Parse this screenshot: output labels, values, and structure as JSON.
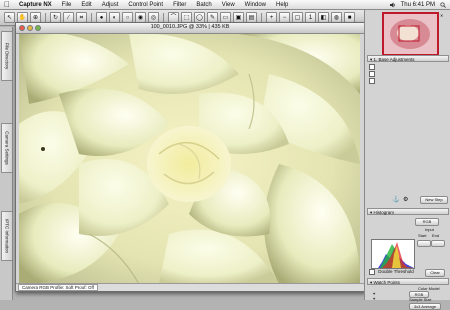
{
  "menubar": {
    "app": "Capture NX",
    "items": [
      "File",
      "Edit",
      "Adjust",
      "Control Point",
      "Filter",
      "Batch",
      "View",
      "Window",
      "Help"
    ],
    "clock": "Thu 6:41 PM"
  },
  "left_dock": {
    "tabs": [
      "File Directory",
      "Camera Settings",
      "IPTC Information"
    ]
  },
  "image_window": {
    "title": "100_0010.JPG @ 33% | 435 KB",
    "status_profile": "Camera RGB Profile: Soft Proof: Off"
  },
  "right_panel": {
    "adjust_header": "1. Base Adjustments",
    "new_step_label": "New Step",
    "histogram_header": "Histogram",
    "histogram_channel": "RGB",
    "input_label": "Input",
    "start_label": "Start",
    "end_label": "End",
    "double_threshold_label": "Double Threshold",
    "clear_label": "Clear",
    "watch_points_header": "Watch Points",
    "color_model_label": "Color Model",
    "color_model_value": "RGB",
    "sample_size_label": "Sample Size",
    "sample_size_value": "3x3 Average"
  },
  "colors": {
    "thumbnail_border": "#c0182b",
    "petal_highlight": "#fbfde8",
    "petal_shadow": "#a9ac74"
  }
}
